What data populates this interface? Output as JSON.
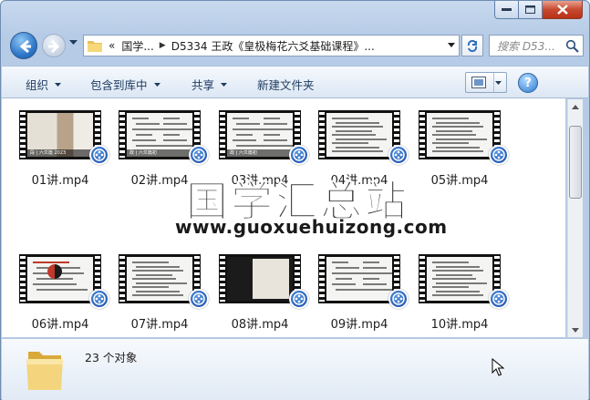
{
  "address": {
    "overflow": "«",
    "crumbs": [
      "国学...",
      "D5334 王政《皇极梅花六爻基础课程》..."
    ]
  },
  "search": {
    "placeholder": "搜索 D53..."
  },
  "commands": {
    "organize": "组织",
    "include_library": "包含到库中",
    "share": "共享",
    "new_folder": "新建文件夹"
  },
  "files": [
    {
      "name": "01讲.mp4",
      "thumb": "hand"
    },
    {
      "name": "02讲.mp4",
      "thumb": "slide-grid"
    },
    {
      "name": "03讲.mp4",
      "thumb": "slide-grid"
    },
    {
      "name": "04讲.mp4",
      "thumb": "slide-text"
    },
    {
      "name": "05讲.mp4",
      "thumb": "slide-text"
    },
    {
      "name": "06讲.mp4",
      "thumb": "slide-taiji"
    },
    {
      "name": "07讲.mp4",
      "thumb": "slide-text"
    },
    {
      "name": "08讲.mp4",
      "thumb": "dark"
    },
    {
      "name": "09讲.mp4",
      "thumb": "slide-grid"
    },
    {
      "name": "10讲.mp4",
      "thumb": "slide-text"
    }
  ],
  "thumb_captions": {
    "c1": "段 | 六爻篇 2023",
    "c2": "政 | 六爻篇初",
    "c3": "政 | 六爻篇初"
  },
  "watermark": {
    "text": "国学汇总站",
    "url": "www.guoxuehuizong.com"
  },
  "status": {
    "count": "23 个对象"
  },
  "colors": {
    "accent": "#1c4fa8",
    "frame": "#b8cde7",
    "close": "#c7492f"
  }
}
